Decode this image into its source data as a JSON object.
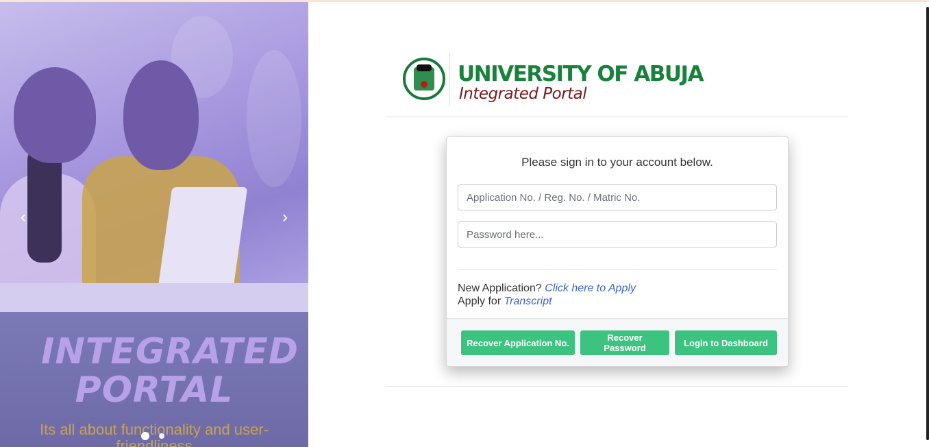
{
  "carousel": {
    "prev_icon": "chevron-left-icon",
    "next_icon": "chevron-right-icon",
    "prev_glyph": "‹",
    "next_glyph": "›",
    "title": "INTEGRATED PORTAL",
    "tagline": "Its all about functionality and user-friendliness",
    "slides_count": 2,
    "active_slide": 1
  },
  "logo": {
    "title": "UNIVERSITY OF ABUJA",
    "subtitle": "Integrated Portal",
    "brand_green": "#17823a",
    "brand_maroon": "#7a1a1a"
  },
  "login": {
    "heading": "Please sign in to your account below.",
    "username_placeholder": "Application No. / Reg. No. / Matric No.",
    "password_placeholder": "Password here...",
    "new_app_text": "New Application?",
    "new_app_link": "Click here to Apply",
    "transcript_text": "Apply for",
    "transcript_link": "Transcript",
    "buttons": {
      "recover_app": "Recover Application No.",
      "recover_password": "Recover Password",
      "login": "Login to Dashboard"
    },
    "button_color": "#3cc37f",
    "link_color": "#3f63c6"
  }
}
